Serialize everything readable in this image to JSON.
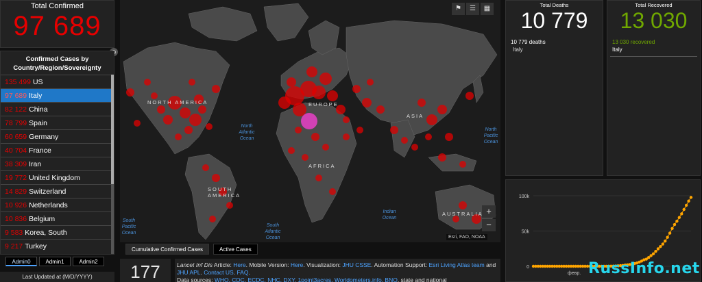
{
  "total_confirmed": {
    "label": "Total Confirmed",
    "value": "97 689"
  },
  "country_list": {
    "header": "Confirmed Cases by Country/Region/Sovereignty",
    "rows": [
      {
        "value": "135 499",
        "name": "US"
      },
      {
        "value": "97 689",
        "name": "Italy"
      },
      {
        "value": "82 122",
        "name": "China"
      },
      {
        "value": "78 799",
        "name": "Spain"
      },
      {
        "value": "60 659",
        "name": "Germany"
      },
      {
        "value": "40 704",
        "name": "France"
      },
      {
        "value": "38 309",
        "name": "Iran"
      },
      {
        "value": "19 772",
        "name": "United Kingdom"
      },
      {
        "value": "14 829",
        "name": "Switzerland"
      },
      {
        "value": "10 926",
        "name": "Netherlands"
      },
      {
        "value": "10 836",
        "name": "Belgium"
      },
      {
        "value": "9 583",
        "name": "Korea, South"
      },
      {
        "value": "9 217",
        "name": "Turkey"
      }
    ],
    "selected": "Italy"
  },
  "admin_tabs": [
    "Admin0",
    "Admin1",
    "Admin2"
  ],
  "last_updated": "Last Updated at (M/D/YYYY)",
  "map": {
    "labels": {
      "north_america": "NORTH AMERICA",
      "europe": "EUROPE",
      "asia": "ASIA",
      "africa": "AFRICA",
      "south_america": "SOUTH AMERICA",
      "australia": "AUSTRALIA"
    },
    "oceans": {
      "north_atlantic": "North Atlantic Ocean",
      "north_pacific": "North Pacific Ocean",
      "indian": "Indian Ocean",
      "south_atlantic": "South Atlantic Ocean",
      "south_pacific": "South Pacific Ocean"
    },
    "attribution": "Esri, FAO, NOAA",
    "zoom_in": "+",
    "zoom_out": "−",
    "tabs": [
      "Cumulative Confirmed Cases",
      "Active Cases"
    ]
  },
  "count_box": "177",
  "info_text": {
    "part1": "Lancet Inf Dis",
    "part2": " Article: ",
    "here1": "Here",
    "part3": ". Mobile Version: ",
    "here2": "Here",
    "part4": ". Visualization: ",
    "jhu": "JHU CSSE",
    "part5": ". Automation Support: ",
    "esri": "Esri Living Atlas team",
    "part6": " and ",
    "apl": "JHU APL",
    "part7": ". ",
    "contact": "Contact US",
    "part8": ". ",
    "faq": "FAQ",
    "part9": ".",
    "line3a": "Data sources: ",
    "line3b": "WHO, CDC, ECDC, NHC, DXY, 1point3acres, Worldometers.info, BNO",
    "line3c": ", state and national"
  },
  "deaths": {
    "label": "Total Deaths",
    "value": "10 779",
    "sub": "10 779 deaths",
    "place": "Italy"
  },
  "recovered": {
    "label": "Total Recovered",
    "value": "13 030",
    "sub_value": "13 030",
    "sub_text": "recovered",
    "place": "Italy"
  },
  "chart_data": {
    "type": "line",
    "y_ticks": [
      "100k",
      "50k",
      "0"
    ],
    "ylim": [
      0,
      100000
    ],
    "x_label": "февр.",
    "values": [
      0,
      0,
      0,
      0,
      0,
      0,
      0,
      0,
      0,
      0,
      0,
      0,
      0,
      0,
      0,
      0,
      0,
      0,
      0,
      0,
      0,
      0,
      0,
      0,
      0,
      0,
      0,
      0,
      0,
      3,
      17,
      79,
      150,
      229,
      322,
      400,
      650,
      888,
      1128,
      1694,
      2036,
      2502,
      3089,
      3858,
      4636,
      5883,
      7375,
      9172,
      10149,
      12462,
      15113,
      17660,
      21157,
      24747,
      27980,
      31506,
      35713,
      41035,
      47021,
      53578,
      59138,
      63927,
      69176,
      74386,
      80589,
      86498,
      92472,
      97689
    ],
    "color": "#ffa500"
  },
  "watermark": "RussInfo.net"
}
